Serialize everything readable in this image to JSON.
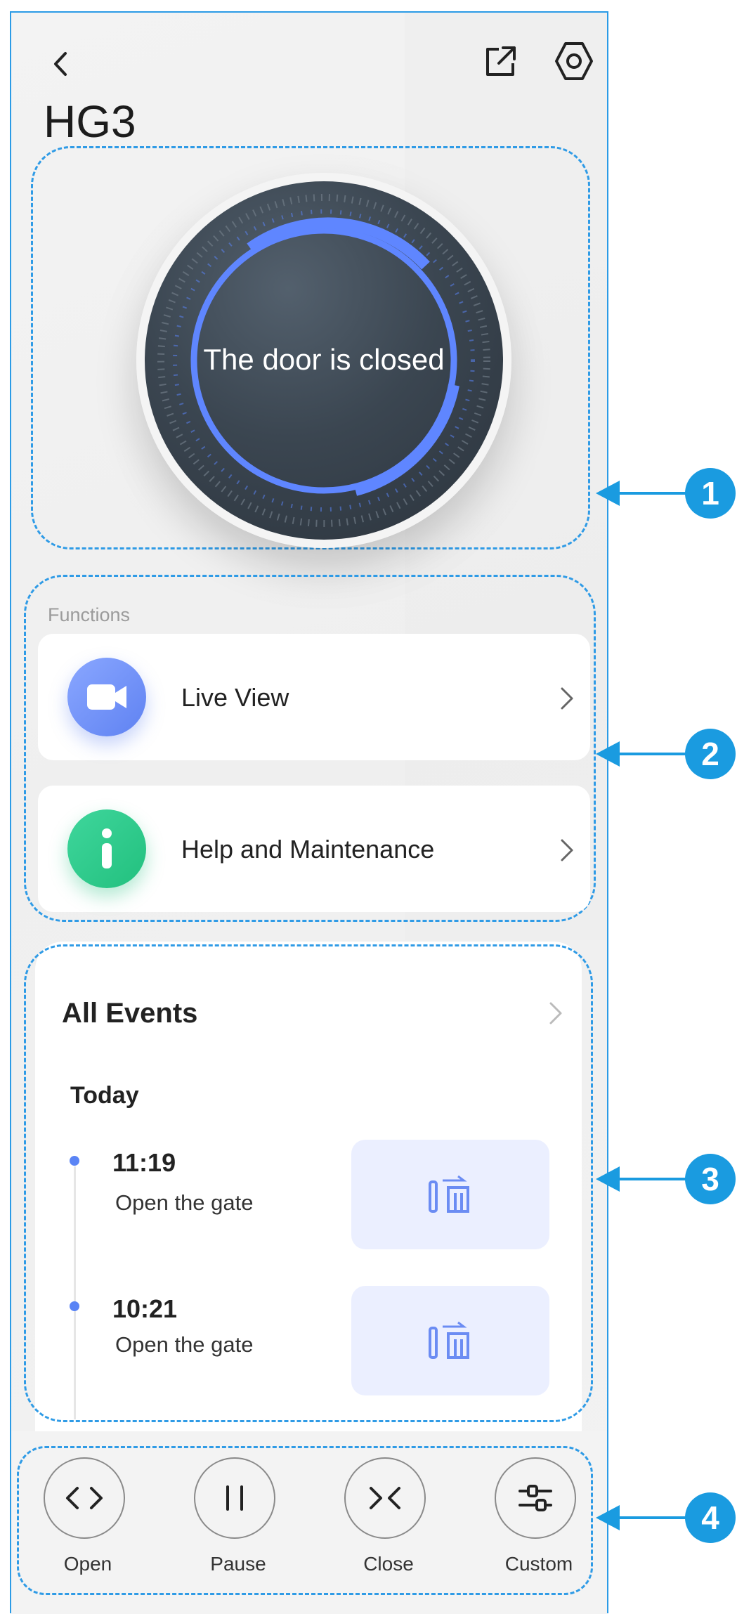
{
  "header": {
    "title": "HG3",
    "back_icon": "chevron-left-icon",
    "share_icon": "external-link-icon",
    "settings_icon": "gear-hexagon-icon"
  },
  "door_status": {
    "text": "The door is closed"
  },
  "functions": {
    "section_label": "Functions",
    "items": [
      {
        "label": "Live View",
        "icon": "video-camera-icon",
        "color": "#6f8ff8"
      },
      {
        "label": "Help and Maintenance",
        "icon": "info-icon",
        "color": "#2fcf8f"
      }
    ]
  },
  "events": {
    "title": "All Events",
    "day_label": "Today",
    "items": [
      {
        "time": "11:19",
        "description": "Open the gate",
        "thumbnail_icon": "gate-open-icon"
      },
      {
        "time": "10:21",
        "description": "Open the gate",
        "thumbnail_icon": "gate-open-icon"
      }
    ]
  },
  "controls": [
    {
      "label": "Open",
      "icon": "open-arrows-icon"
    },
    {
      "label": "Pause",
      "icon": "pause-icon"
    },
    {
      "label": "Close",
      "icon": "close-arrows-icon"
    },
    {
      "label": "Custom",
      "icon": "sliders-icon"
    }
  ],
  "callouts": [
    "1",
    "2",
    "3",
    "4"
  ],
  "colors": {
    "accent_blue": "#5a84f5",
    "callout_blue": "#1a9be0",
    "dashed_border": "#2f9be6"
  }
}
